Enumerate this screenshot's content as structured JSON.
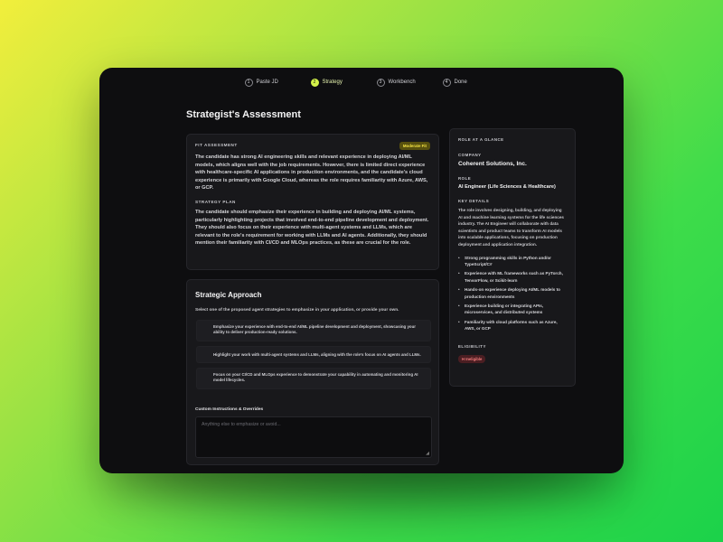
{
  "stepper": {
    "steps": [
      {
        "num": "1",
        "label": "Paste JD"
      },
      {
        "num": "2",
        "label": "Strategy"
      },
      {
        "num": "3",
        "label": "Workbench"
      },
      {
        "num": "4",
        "label": "Done"
      }
    ],
    "active_index": 1
  },
  "page": {
    "title": "Strategist's Assessment"
  },
  "fit": {
    "label": "FIT ASSESSMENT",
    "badge": "Moderate Fit",
    "assessment": "The candidate has strong AI engineering skills and relevant experience in deploying AI/ML models, which aligns well with the job requirements. However, there is limited direct experience with healthcare-specific AI applications in production environments, and the candidate's cloud experience is primarily with Google Cloud, whereas the role requires familiarity with Azure, AWS, or GCP.",
    "plan_label": "STRATEGY PLAN",
    "plan": "The candidate should emphasize their experience in building and deploying AI/ML systems, particularly highlighting projects that involved end-to-end pipeline development and deployment. They should also focus on their experience with multi-agent systems and LLMs, which are relevant to the role's requirement for working with LLMs and AI agents. Additionally, they should mention their familiarity with CI/CD and MLOps practices, as these are crucial for the role."
  },
  "approach": {
    "title": "Strategic Approach",
    "description": "Select one of the proposed agent strategies to emphasize in your application, or provide your own.",
    "options": [
      "Emphasize your experience with end-to-end AI/ML pipeline development and deployment, showcasing your ability to deliver production-ready solutions.",
      "Highlight your work with multi-agent systems and LLMs, aligning with the role's focus on AI agents and LLMs.",
      "Focus on your CI/CD and MLOps experience to demonstrate your capability in automating and monitoring AI model lifecycles."
    ],
    "custom_label": "Custom Instructions & Overrides",
    "custom_placeholder": "Anything else to emphasize or avoid..."
  },
  "role": {
    "label": "ROLE AT A GLANCE",
    "company_label": "COMPANY",
    "company": "Coherent Solutions, Inc.",
    "role_label": "ROLE",
    "role": "AI Engineer (Life Sciences & Healthcare)",
    "key_label": "KEY DETAILS",
    "details": "The role involves designing, building, and deploying AI and machine learning systems for the life sciences industry. The AI Engineer will collaborate with data scientists and product teams to transform AI models into scalable applications, focusing on production deployment and application integration.",
    "bullets": [
      "Strong programming skills in Python and/or TypeScript/C#",
      "Experience with ML frameworks such as PyTorch, TensorFlow, or Scikit-learn",
      "Hands-on experience deploying AI/ML models to production environments",
      "Experience building or integrating APIs, microservices, and distributed systems",
      "Familiarity with cloud platforms such as Azure, AWS, or GCP"
    ],
    "elig_label": "ELIGIBILITY",
    "elig_badge": "H Ineligible"
  },
  "colors": {
    "accent": "#d3f24a",
    "badge_moderate": "#f4e245",
    "badge_ineligible": "#f07b7b"
  }
}
